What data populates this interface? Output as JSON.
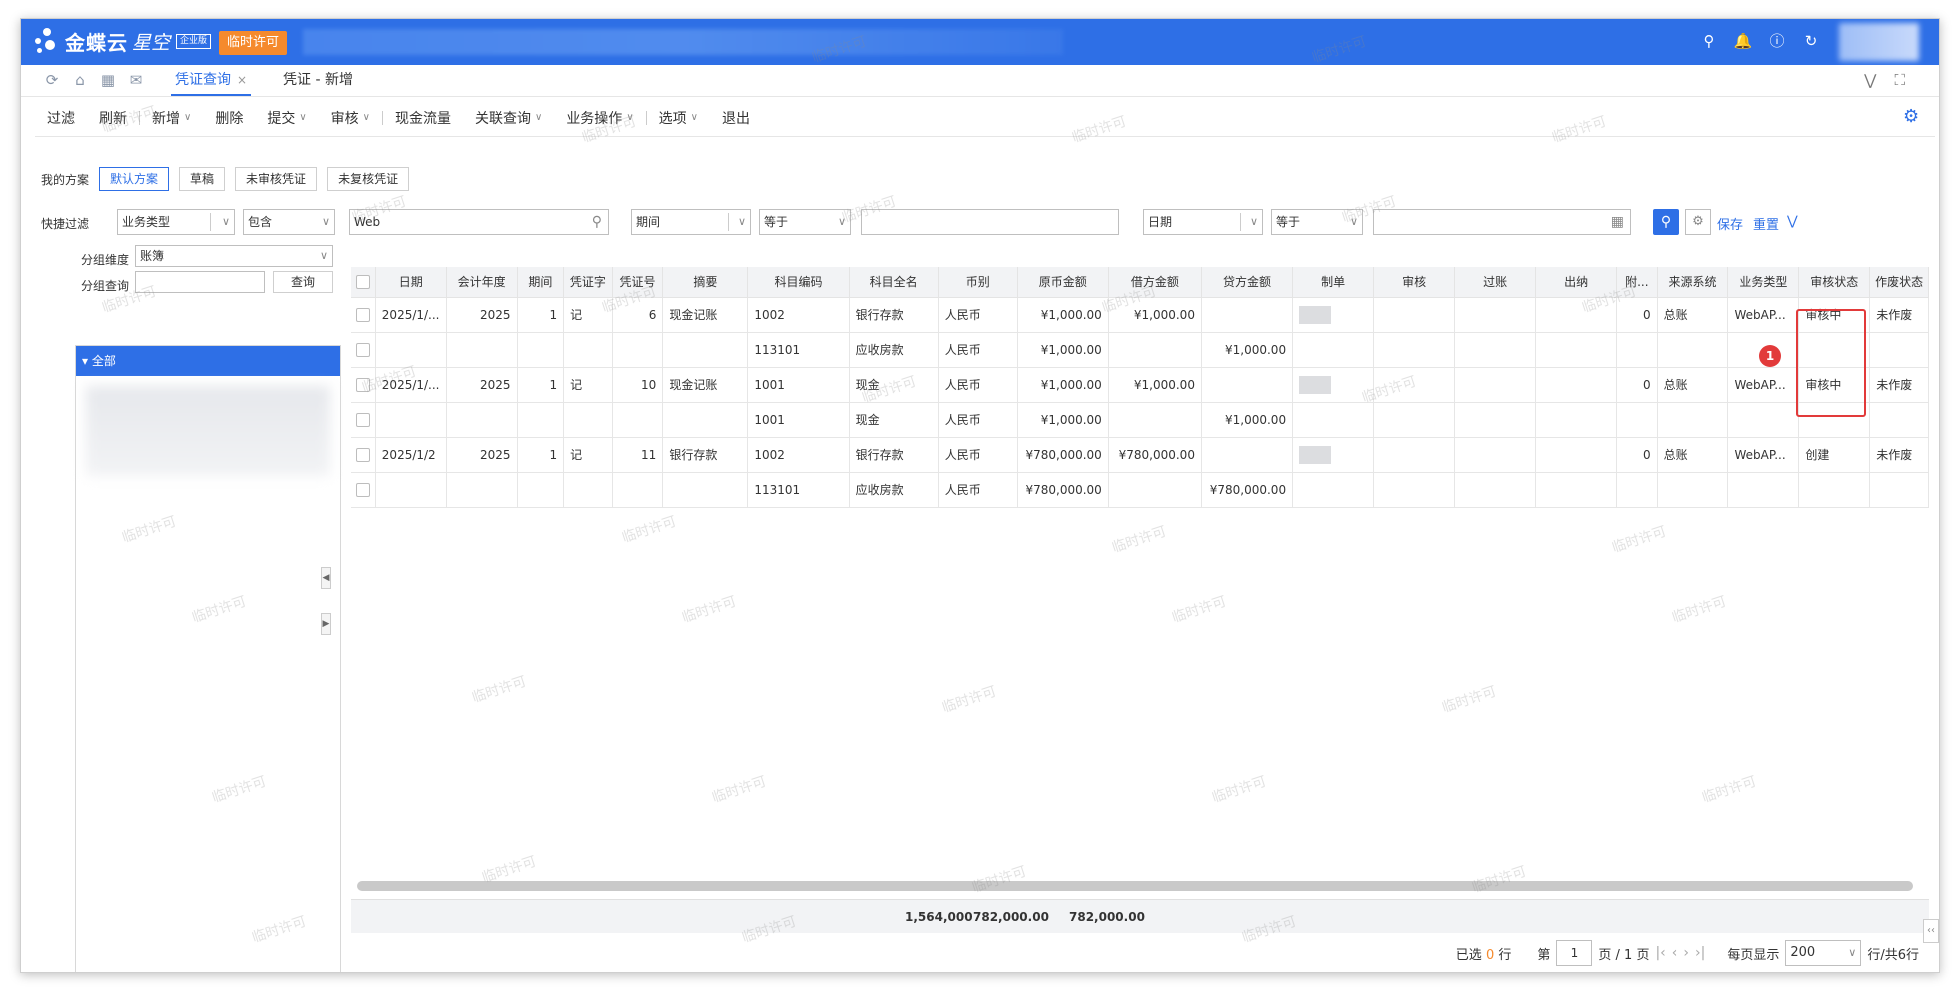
{
  "app": {
    "logo_text": "金蝶云",
    "logo_sub": "星空",
    "edition_badge": "企业版",
    "license_tag": "临时许可"
  },
  "top_icons": [
    "search-icon",
    "bell-icon",
    "help-icon",
    "refresh-icon"
  ],
  "tabs": [
    {
      "label": "凭证查询",
      "active": true
    },
    {
      "label": "凭证 - 新增",
      "active": false
    }
  ],
  "toolbar": {
    "items": [
      {
        "label": "过滤",
        "dropdown": false
      },
      {
        "label": "刷新",
        "dropdown": false
      },
      {
        "label": "新增",
        "dropdown": true
      },
      {
        "label": "删除",
        "dropdown": false
      },
      {
        "label": "提交",
        "dropdown": true
      },
      {
        "label": "审核",
        "dropdown": true
      },
      {
        "label": "现金流量",
        "dropdown": false
      },
      {
        "label": "关联查询",
        "dropdown": true
      },
      {
        "label": "业务操作",
        "dropdown": true
      },
      {
        "label": "选项",
        "dropdown": true
      },
      {
        "label": "退出",
        "dropdown": false
      }
    ]
  },
  "scheme": {
    "label": "我的方案",
    "buttons": [
      "默认方案",
      "草稿",
      "未审核凭证",
      "未复核凭证"
    ]
  },
  "quick_filter": {
    "label": "快捷过滤",
    "field1": "业务类型",
    "op1": "包含",
    "value1": "Web",
    "field2": "期间",
    "op2": "等于",
    "value2": "",
    "field3": "日期",
    "op3": "等于",
    "value3": "",
    "save": "保存",
    "reset": "重置"
  },
  "left": {
    "group_dim_label": "分组维度",
    "group_dim_value": "账簿",
    "group_query_label": "分组查询",
    "query_button": "查询",
    "tree_root": "全部"
  },
  "grid": {
    "columns": [
      "日期",
      "会计年度",
      "期间",
      "凭证字",
      "凭证号",
      "摘要",
      "科目编码",
      "科目全名",
      "币别",
      "原币金额",
      "借方金额",
      "贷方金额",
      "制单",
      "审核",
      "过账",
      "出纳",
      "附...",
      "来源系统",
      "业务类型",
      "审核状态",
      "作废状态"
    ],
    "rows": [
      {
        "date": "2025/1/...",
        "year": "2025",
        "period": "1",
        "word": "记",
        "no": "6",
        "summary": "现金记账",
        "code": "1002",
        "account": "银行存款",
        "currency": "人民币",
        "orig": "¥1,000.00",
        "debit": "¥1,000.00",
        "credit": "",
        "maker": true,
        "attach": "0",
        "source": "总账",
        "biz": "WebAP...",
        "status": "审核中",
        "void": "未作废"
      },
      {
        "date": "",
        "year": "",
        "period": "",
        "word": "",
        "no": "",
        "summary": "",
        "code": "113101",
        "account": "应收房款",
        "currency": "人民币",
        "orig": "¥1,000.00",
        "debit": "",
        "credit": "¥1,000.00",
        "maker": false,
        "attach": "",
        "source": "",
        "biz": "",
        "status": "",
        "void": ""
      },
      {
        "date": "2025/1/...",
        "year": "2025",
        "period": "1",
        "word": "记",
        "no": "10",
        "summary": "现金记账",
        "code": "1001",
        "account": "现金",
        "currency": "人民币",
        "orig": "¥1,000.00",
        "debit": "¥1,000.00",
        "credit": "",
        "maker": true,
        "attach": "0",
        "source": "总账",
        "biz": "WebAP...",
        "status": "审核中",
        "void": "未作废"
      },
      {
        "date": "",
        "year": "",
        "period": "",
        "word": "",
        "no": "",
        "summary": "",
        "code": "1001",
        "account": "现金",
        "currency": "人民币",
        "orig": "¥1,000.00",
        "debit": "",
        "credit": "¥1,000.00",
        "maker": false,
        "attach": "",
        "source": "",
        "biz": "",
        "status": "",
        "void": ""
      },
      {
        "date": "2025/1/2",
        "year": "2025",
        "period": "1",
        "word": "记",
        "no": "11",
        "summary": "银行存款",
        "code": "1002",
        "account": "银行存款",
        "currency": "人民币",
        "orig": "¥780,000.00",
        "debit": "¥780,000.00",
        "credit": "",
        "maker": true,
        "attach": "0",
        "source": "总账",
        "biz": "WebAP...",
        "status": "创建",
        "void": "未作废"
      },
      {
        "date": "",
        "year": "",
        "period": "",
        "word": "",
        "no": "",
        "summary": "",
        "code": "113101",
        "account": "应收房款",
        "currency": "人民币",
        "orig": "¥780,000.00",
        "debit": "",
        "credit": "¥780,000.00",
        "maker": false,
        "attach": "",
        "source": "",
        "biz": "",
        "status": "",
        "void": ""
      }
    ],
    "totals": {
      "orig": "1,564,000",
      "debit": "782,000.00",
      "credit": "782,000.00"
    }
  },
  "pager": {
    "selected_prefix": "已选",
    "selected_count": "0",
    "selected_suffix": "行",
    "page_prefix": "第",
    "page": "1",
    "page_suffix": "页 / 1 页",
    "per_page_label": "每页显示",
    "per_page": "200",
    "total": "行/共6行"
  },
  "annotation": {
    "marker": "1"
  },
  "watermark": "临时许可",
  "colors": {
    "primary": "#2e6fe6",
    "license": "#f58a2d",
    "highlight": "#e23a3a"
  }
}
